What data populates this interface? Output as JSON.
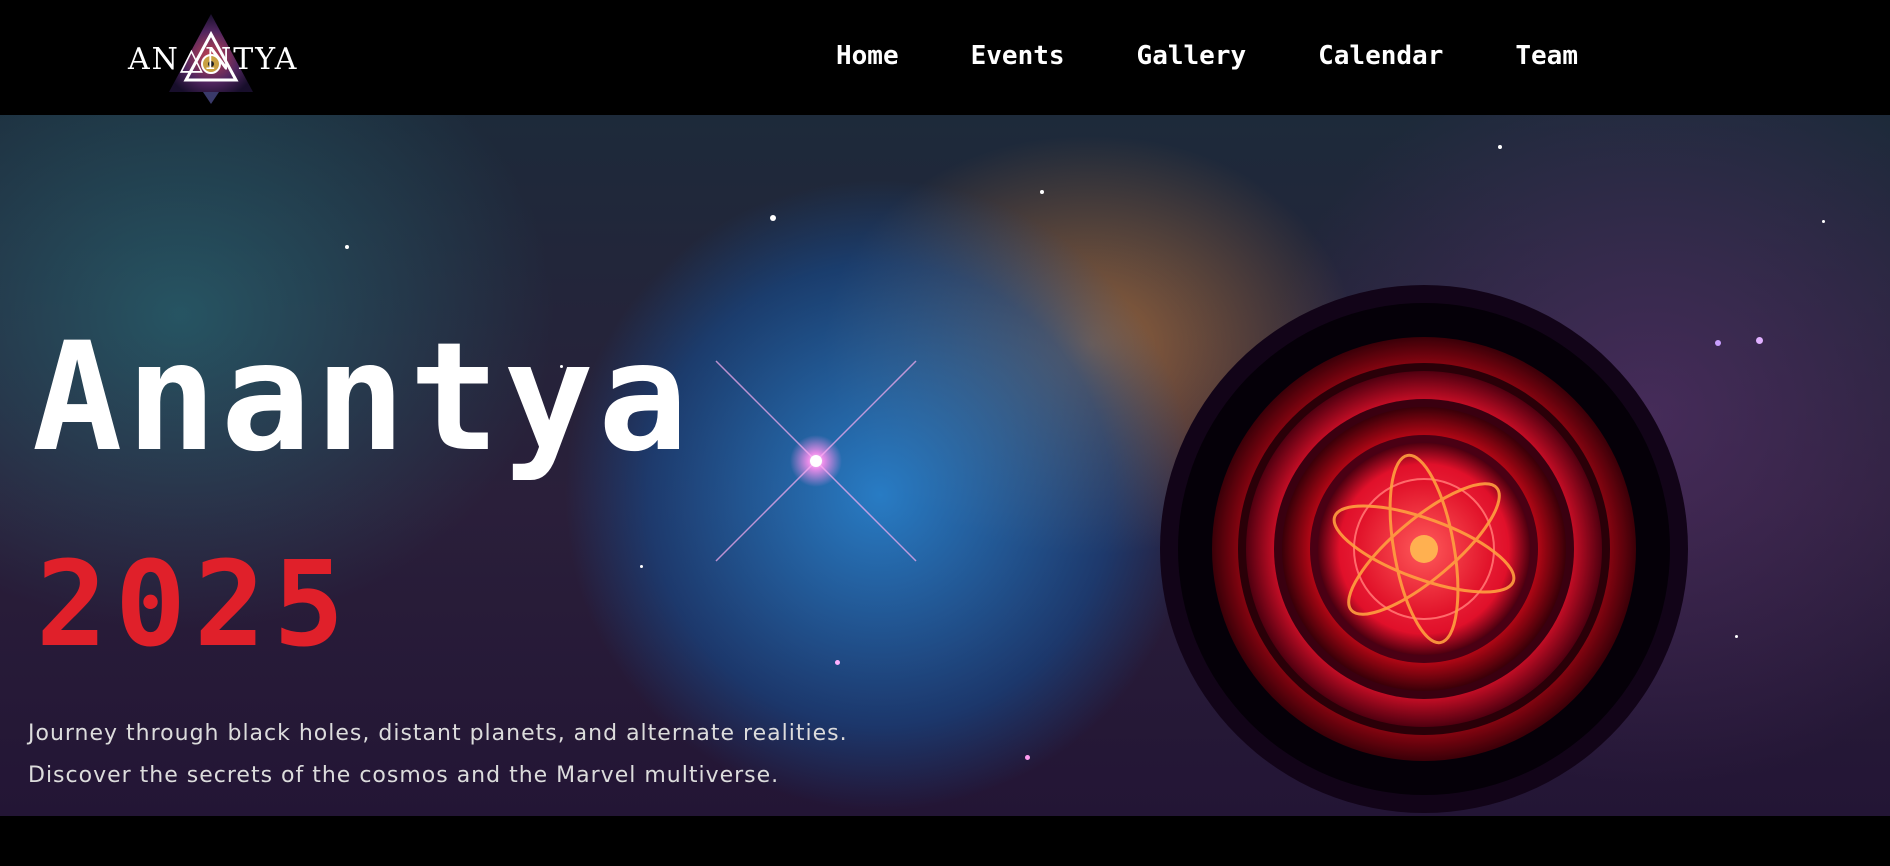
{
  "brand": {
    "logo_text": "AN△NTYA",
    "logo_icon": "triangle-emblem"
  },
  "nav": {
    "items": [
      {
        "label": "Home"
      },
      {
        "label": "Events"
      },
      {
        "label": "Gallery"
      },
      {
        "label": "Calendar"
      },
      {
        "label": "Team"
      }
    ]
  },
  "hero": {
    "title": "Anantya",
    "year": "2025",
    "description_line1": "Journey through black holes, distant planets, and alternate realities.",
    "description_line2": "Discover the secrets of the cosmos and the Marvel multiverse.",
    "orb_icon": "atom-orb-illustration"
  },
  "colors": {
    "background": "#000000",
    "accent_red": "#e0202a",
    "text_white": "#ffffff"
  }
}
